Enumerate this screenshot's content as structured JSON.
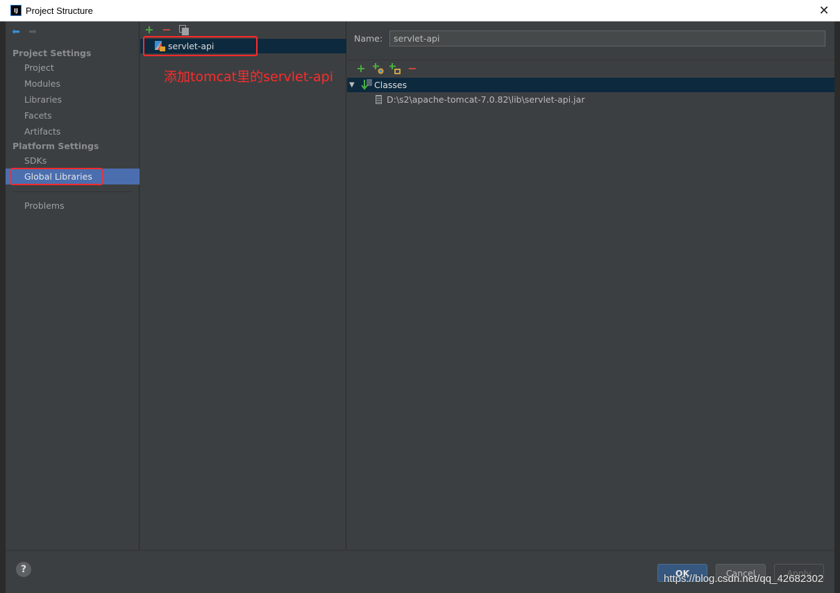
{
  "window": {
    "title": "Project Structure",
    "close_glyph": "✕",
    "app_icon_text": "IJ"
  },
  "sidebar": {
    "back_glyph": "⬅",
    "forward_glyph": "➡",
    "project_settings_header": "Project Settings",
    "project_items": [
      {
        "label": "Project"
      },
      {
        "label": "Modules"
      },
      {
        "label": "Libraries"
      },
      {
        "label": "Facets"
      },
      {
        "label": "Artifacts"
      }
    ],
    "platform_settings_header": "Platform Settings",
    "platform_items": [
      {
        "label": "SDKs"
      },
      {
        "label": "Global Libraries",
        "selected": true
      }
    ],
    "problems_label": "Problems"
  },
  "list_panel": {
    "add_glyph": "+",
    "remove_glyph": "−",
    "library_name": "servlet-api",
    "annotation": "添加tomcat里的servlet-api"
  },
  "detail_panel": {
    "name_label": "Name:",
    "name_value": "servlet-api",
    "toolbar": {
      "add_glyph": "+",
      "remove_glyph": "−"
    },
    "tree": {
      "toggle_glyph": "▼",
      "classes_label": "Classes",
      "jar_path": "D:\\s2\\apache-tomcat-7.0.82\\lib\\servlet-api.jar"
    }
  },
  "bottom_bar": {
    "help_glyph": "?",
    "ok_label": "OK",
    "cancel_label": "Cancel",
    "apply_label": "Apply"
  },
  "watermark": "https://blog.csdn.net/qq_42682302",
  "colors": {
    "background": "#3c3f41",
    "selection": "#4b6eaf",
    "tree_selection": "#0d293e",
    "annotation_red": "#ff2b2b",
    "add_green": "#4ab040",
    "remove_red": "#d9483b"
  }
}
